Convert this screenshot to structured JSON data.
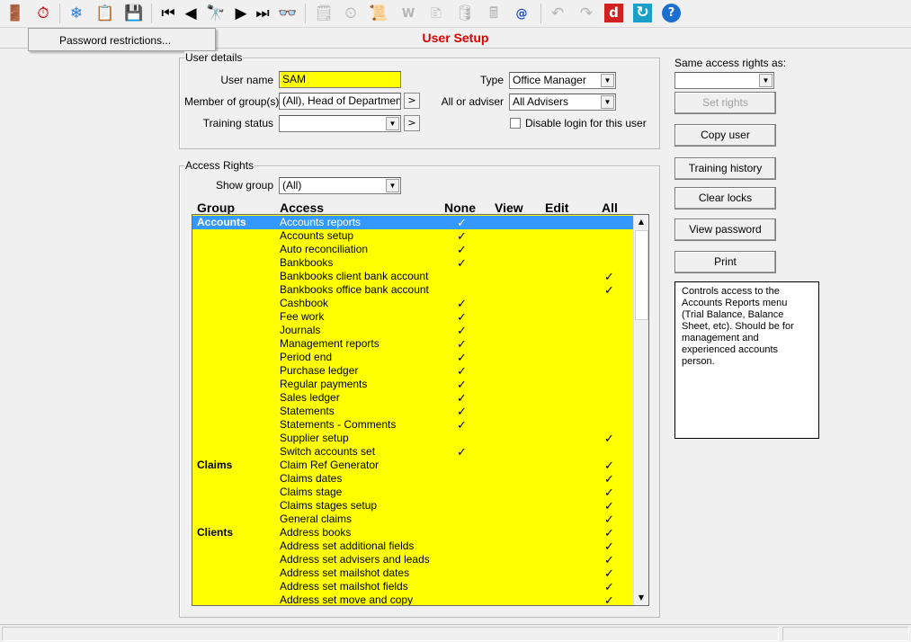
{
  "menu_popup": {
    "label": "Password restrictions..."
  },
  "title": "User Setup",
  "user_details": {
    "legend": "User details",
    "user_name_label": "User name",
    "user_name": "SAM",
    "member_label": "Member of group(s)",
    "member_value": "(All), Head of Department, S",
    "training_label": "Training status",
    "training_value": "",
    "type_label": "Type",
    "type_value": "Office Manager",
    "adviser_label": "All or adviser",
    "adviser_value": "All Advisers",
    "disable_label": "Disable login for this user",
    "more_symbol": ">"
  },
  "right_panel": {
    "same_rights_label": "Same access rights as:",
    "same_rights_value": "",
    "set_rights": "Set rights",
    "copy_user": "Copy user",
    "training_history": "Training history",
    "clear_locks": "Clear locks",
    "view_password": "View password",
    "print": "Print",
    "help_text": "Controls access to the Accounts Reports menu (Trial Balance, Balance Sheet, etc). Should be for management and experienced accounts person."
  },
  "access_rights": {
    "legend": "Access Rights",
    "show_group_label": "Show group",
    "show_group_value": "(All)",
    "headers": {
      "group": "Group",
      "access": "Access",
      "none": "None",
      "view": "View",
      "edit": "Edit",
      "all": "All"
    },
    "check": "✓",
    "rows": [
      {
        "group": "Accounts",
        "access": "Accounts reports",
        "level": "none",
        "selected": true
      },
      {
        "group": "",
        "access": "Accounts setup",
        "level": "none"
      },
      {
        "group": "",
        "access": "Auto reconciliation",
        "level": "none"
      },
      {
        "group": "",
        "access": "Bankbooks",
        "level": "none"
      },
      {
        "group": "",
        "access": "Bankbooks client bank account",
        "level": "all"
      },
      {
        "group": "",
        "access": "Bankbooks office bank account",
        "level": "all"
      },
      {
        "group": "",
        "access": "Cashbook",
        "level": "none"
      },
      {
        "group": "",
        "access": "Fee work",
        "level": "none"
      },
      {
        "group": "",
        "access": "Journals",
        "level": "none"
      },
      {
        "group": "",
        "access": "Management reports",
        "level": "none"
      },
      {
        "group": "",
        "access": "Period end",
        "level": "none"
      },
      {
        "group": "",
        "access": "Purchase ledger",
        "level": "none"
      },
      {
        "group": "",
        "access": "Regular payments",
        "level": "none"
      },
      {
        "group": "",
        "access": "Sales ledger",
        "level": "none"
      },
      {
        "group": "",
        "access": "Statements",
        "level": "none"
      },
      {
        "group": "",
        "access": "Statements - Comments",
        "level": "none"
      },
      {
        "group": "",
        "access": "Supplier setup",
        "level": "all"
      },
      {
        "group": "",
        "access": "Switch accounts set",
        "level": "none"
      },
      {
        "group": "Claims",
        "access": "Claim Ref Generator",
        "level": "all"
      },
      {
        "group": "",
        "access": "Claims dates",
        "level": "all"
      },
      {
        "group": "",
        "access": "Claims stage",
        "level": "all"
      },
      {
        "group": "",
        "access": "Claims stages setup",
        "level": "all"
      },
      {
        "group": "",
        "access": "General claims",
        "level": "all"
      },
      {
        "group": "Clients",
        "access": "Address books",
        "level": "all"
      },
      {
        "group": "",
        "access": "Address set additional fields",
        "level": "all"
      },
      {
        "group": "",
        "access": "Address set advisers and leads",
        "level": "all"
      },
      {
        "group": "",
        "access": "Address set mailshot dates",
        "level": "all"
      },
      {
        "group": "",
        "access": "Address set mailshot fields",
        "level": "all"
      },
      {
        "group": "",
        "access": "Address set move and copy",
        "level": "all"
      }
    ]
  },
  "toolbar": {
    "icons": [
      "exit-door-icon",
      "clock-forward-icon",
      "snowflake-icon",
      "clipboard-icon",
      "save-icon",
      "first-record-icon",
      "previous-record-icon",
      "find-binoculars-icon",
      "next-record-icon",
      "last-record-icon",
      "glasses-icon",
      "notepad-icon",
      "stopwatch-icon",
      "scroll-icon",
      "word-icon",
      "note-icon",
      "database-icon",
      "calculator-icon",
      "email-icon",
      "undo-icon",
      "redo-icon",
      "d-app-icon",
      "refresh-icon",
      "help-icon"
    ],
    "glyphs": [
      "🚪",
      "⏱",
      "❄",
      "📋",
      "💾",
      "⏮",
      "◀",
      "🔭",
      "▶",
      "⏭",
      "👓",
      "🗒",
      "⏲",
      "📜",
      "W",
      "🗈",
      "🛢",
      "🖩",
      "@",
      "↶",
      "↷",
      "d",
      "↻",
      "?"
    ]
  }
}
